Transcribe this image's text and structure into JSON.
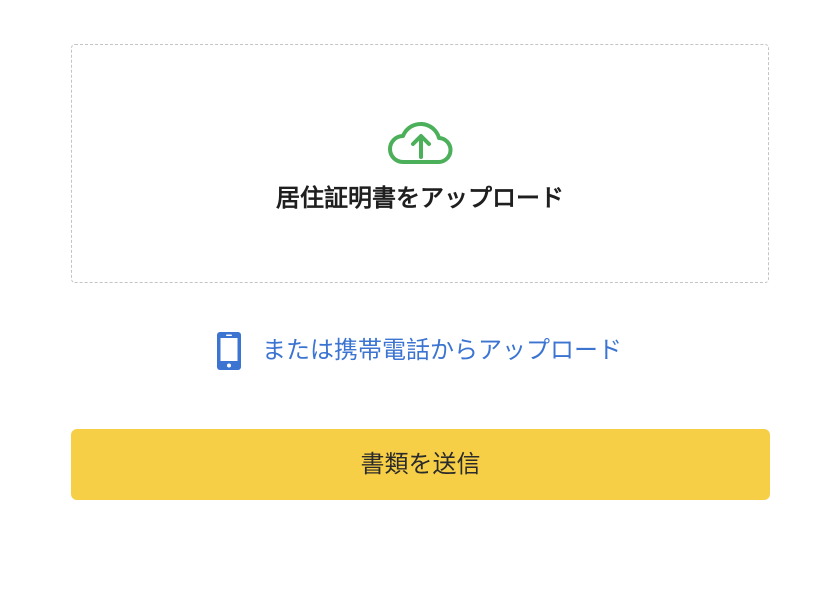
{
  "upload": {
    "icon": "cloud-upload-icon",
    "icon_color": "#4caf5a",
    "label": "居住証明書をアップロード"
  },
  "mobile_upload": {
    "icon": "smartphone-icon",
    "icon_color": "#3b74d1",
    "label": "または携帯電話からアップロード"
  },
  "submit": {
    "label": "書類を送信",
    "color": "#f7cf47"
  }
}
